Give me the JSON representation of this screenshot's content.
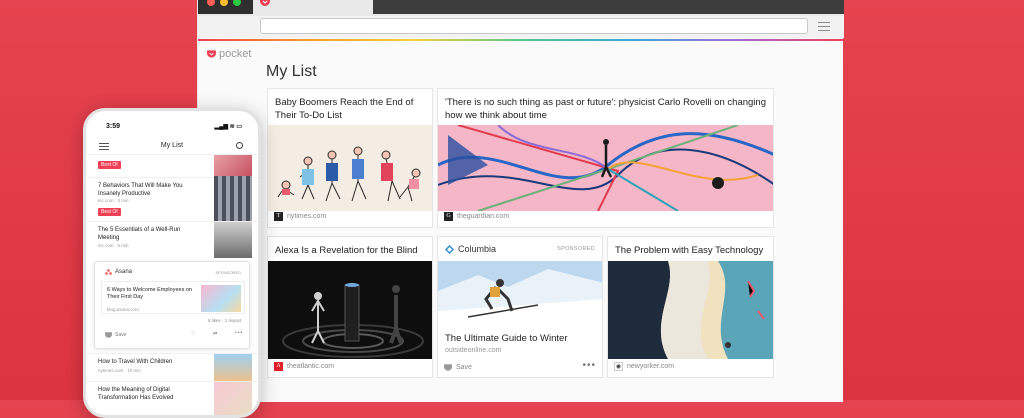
{
  "browser": {
    "brand": "pocket",
    "page_title": "My List"
  },
  "cards": {
    "c1": {
      "title": "Baby Boomers Reach the End of Their To-Do List",
      "source": "nytimes.com",
      "fav": "T"
    },
    "c2": {
      "title": "'There is no such thing as past or future': physicist Carlo Rovelli on changing how we think about time",
      "source": "theguardian.com",
      "fav": "G"
    },
    "c3": {
      "title": "Alexa Is a Revelation for the Blind",
      "source": "theatlantic.com",
      "fav": "A"
    },
    "c4": {
      "brand": "Columbia",
      "sponsored": "SPONSORED",
      "title": "The Ultimate Guide to Winter",
      "source": "outsideonline.com",
      "save": "Save",
      "more": "•••"
    },
    "c5": {
      "title": "The Problem with Easy Technology",
      "source": "newyorker.com"
    }
  },
  "phone": {
    "time": "3:59",
    "status_icons": "▂▄▆ ≋ ▭",
    "title": "My List",
    "items": [
      {
        "badge": "Best Of",
        "title": "",
        "meta": ""
      },
      {
        "badge": "",
        "title": "7 Behaviors That Will Make You Insanely Productive",
        "meta": "inc.com · 3 min"
      },
      {
        "badge": "Best Of",
        "title": "The 5 Essentials of a Well-Run Meeting",
        "meta": "inc.com · 5 min"
      },
      {
        "badge": "",
        "title": "How to Travel With Children",
        "meta": "nytimes.com · 10 min"
      },
      {
        "badge": "",
        "title": "How the Meaning of Digital Transformation Has Evolved",
        "meta": ""
      }
    ],
    "ad": {
      "brand": "Asana",
      "sponsored": "SPONSORED",
      "title": "6 Ways to Welcome Employees on Their First Day",
      "meta": "blog.asana.com",
      "likes": "8 likes · 1 repost",
      "save": "Save"
    }
  }
}
